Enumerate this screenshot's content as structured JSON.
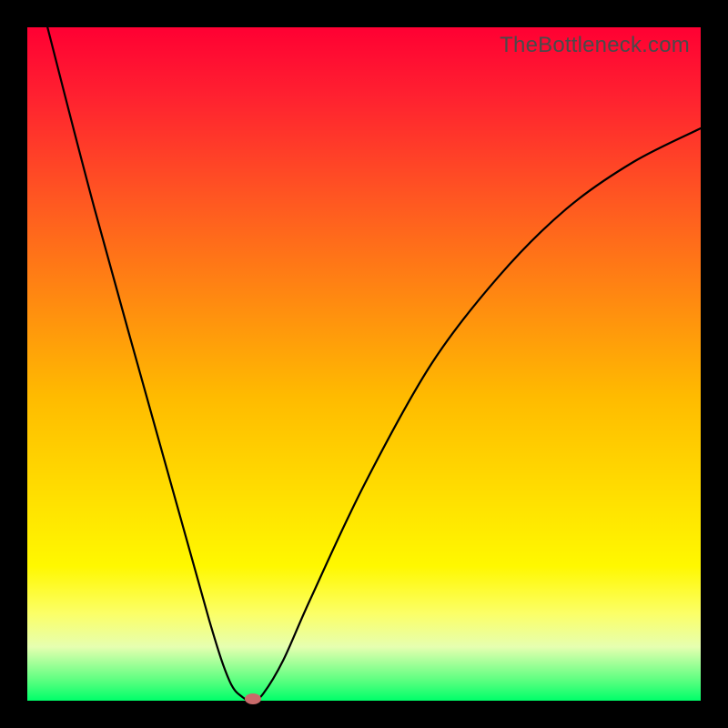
{
  "watermark": "TheBottleneck.com",
  "chart_data": {
    "type": "line",
    "title": "",
    "xlabel": "",
    "ylabel": "",
    "xlim": [
      0,
      100
    ],
    "ylim": [
      0,
      100
    ],
    "series": [
      {
        "name": "curve",
        "x": [
          3,
          10,
          20,
          27,
          30,
          32,
          33.5,
          35,
          38,
          42,
          50,
          60,
          70,
          80,
          90,
          100
        ],
        "values": [
          100,
          73,
          37,
          12,
          3,
          0.5,
          0,
          1,
          6,
          15,
          32,
          50,
          63,
          73,
          80,
          85
        ]
      }
    ],
    "marker": {
      "x": 33.5,
      "y": 0.3
    },
    "grid": false,
    "legend": false
  }
}
